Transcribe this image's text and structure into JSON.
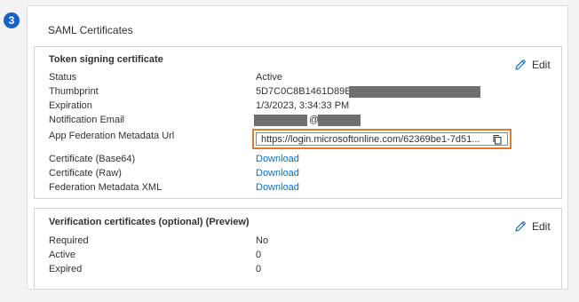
{
  "step": {
    "number": "3"
  },
  "saml": {
    "title": "SAML Certificates",
    "token": {
      "heading": "Token signing certificate",
      "edit_label": "Edit",
      "fields": {
        "status": {
          "label": "Status",
          "value": "Active"
        },
        "thumbprint": {
          "label": "Thumbprint",
          "value": "5D7C0C8B1461D89E35C"
        },
        "expiration": {
          "label": "Expiration",
          "value": "1/3/2023, 3:34:33 PM"
        },
        "notification_email": {
          "label": "Notification Email",
          "value": "@"
        },
        "metadata_url": {
          "label": "App Federation Metadata Url",
          "value": "https://login.microsoftonline.com/62369be1-7d51..."
        },
        "cert_base64": {
          "label": "Certificate (Base64)",
          "link": "Download"
        },
        "cert_raw": {
          "label": "Certificate (Raw)",
          "link": "Download"
        },
        "federation_xml": {
          "label": "Federation Metadata XML",
          "link": "Download"
        }
      }
    },
    "verification": {
      "heading": "Verification certificates (optional) (Preview)",
      "edit_label": "Edit",
      "fields": {
        "required": {
          "label": "Required",
          "value": "No"
        },
        "active": {
          "label": "Active",
          "value": "0"
        },
        "expired": {
          "label": "Expired",
          "value": "0"
        }
      }
    }
  },
  "colors": {
    "accent_blue": "#1463c6",
    "link_blue": "#0f6cbd",
    "highlight_orange": "#e07b2a",
    "redaction_gray": "#6f6f6f"
  },
  "icons": {
    "edit": "pencil-icon",
    "copy": "copy-icon"
  }
}
